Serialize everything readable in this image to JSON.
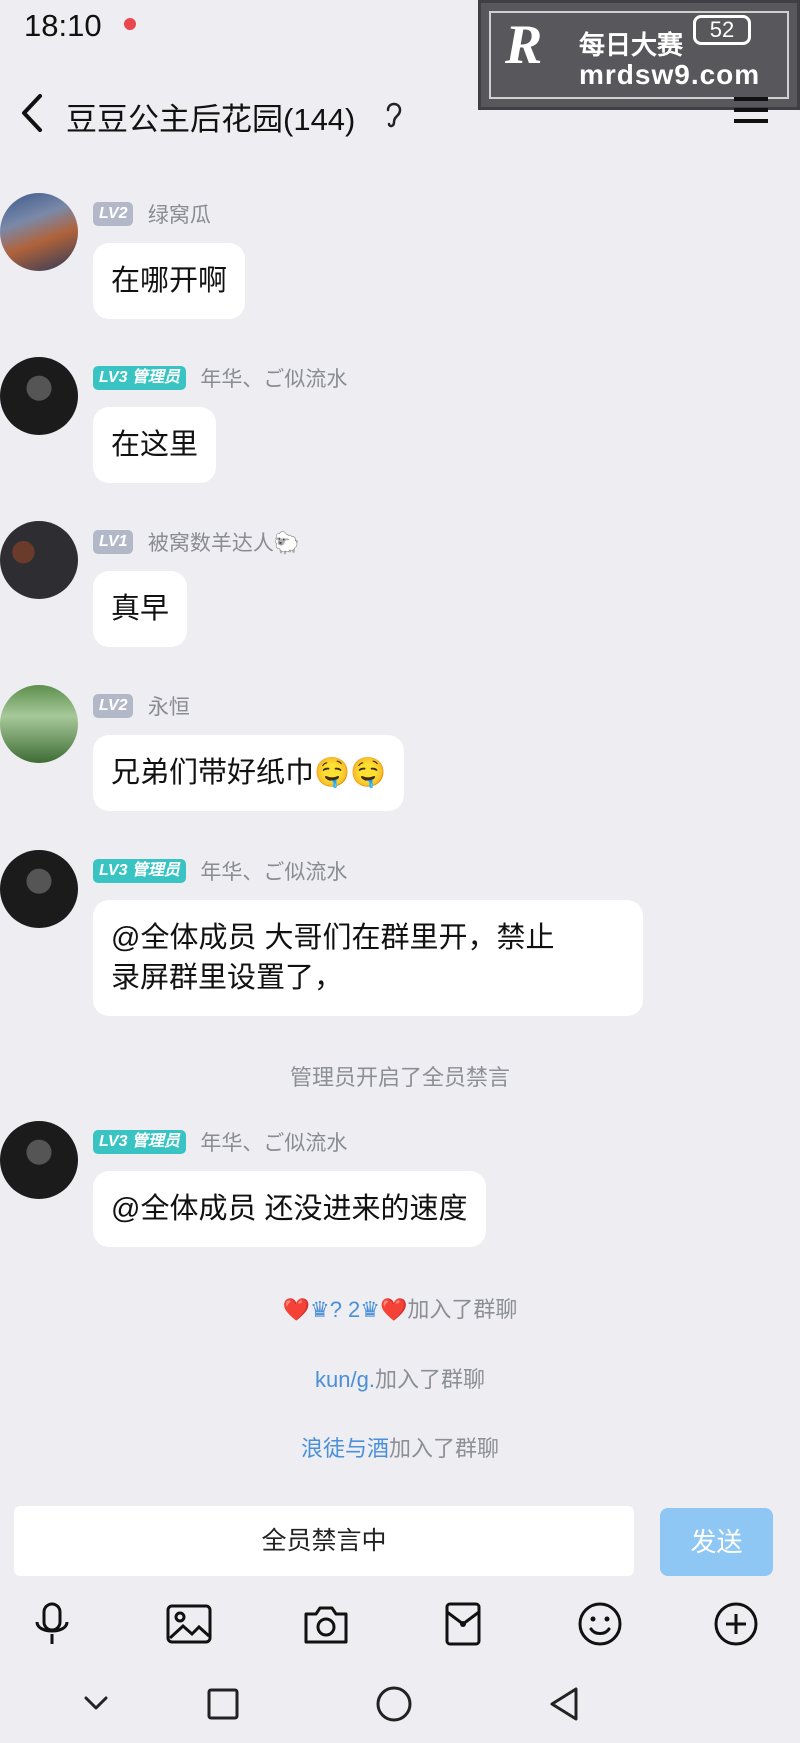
{
  "status_bar": {
    "time": "18:10"
  },
  "watermark": {
    "logo": "R",
    "title": "每日大赛",
    "url": "mrdsw9.com",
    "battery": "52"
  },
  "header": {
    "title": "豆豆公主后花园(144)"
  },
  "messages": [
    {
      "level": "LV2",
      "nick": "绿窝瓜",
      "text": "在哪开啊"
    },
    {
      "level": "LV3 管理员",
      "nick": "年华、ご似流水",
      "text": "在这里"
    },
    {
      "level": "LV1",
      "nick": "被窝数羊达人🐑",
      "text": "真早"
    },
    {
      "level": "LV2",
      "nick": "永恒",
      "text": "兄弟们带好纸巾🤤🤤"
    },
    {
      "level": "LV3 管理员",
      "nick": "年华、ご似流水",
      "text_line1": "@全体成员 大哥们在群里开，禁止",
      "text_line2": "录屏群里设置了，"
    },
    {
      "level": "LV3 管理员",
      "nick": "年华、ご似流水",
      "text": "@全体成员 还没进来的速度"
    }
  ],
  "system": {
    "mute_notice": "管理员开启了全员禁言",
    "join1_name": "❤️♛? 2♛❤️",
    "join2_name": "kun/g.",
    "join3_name": "浪徒与酒",
    "joined_suffix": "加入了群聊"
  },
  "input": {
    "placeholder": "全员禁言中",
    "send_label": "发送"
  },
  "icons": [
    "back-icon",
    "ear-icon",
    "menu-icon",
    "mic-icon",
    "image-icon",
    "camera-icon",
    "red-packet-icon",
    "emoji-icon",
    "plus-icon",
    "chevron-down-icon",
    "square-icon",
    "circle-icon",
    "triangle-back-icon"
  ]
}
